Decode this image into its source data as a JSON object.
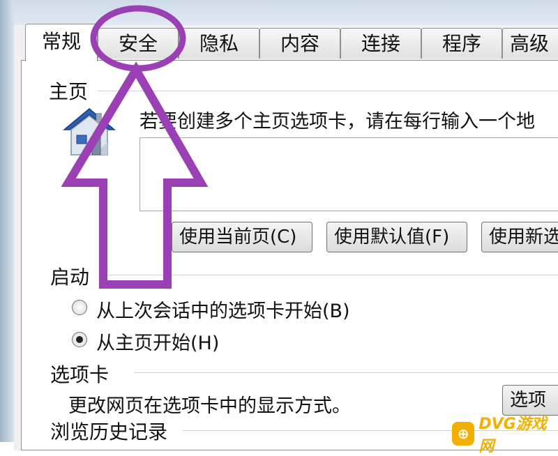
{
  "tabs": [
    "常规",
    "安全",
    "隐私",
    "内容",
    "连接",
    "程序",
    "高级"
  ],
  "home": {
    "group_title": "主页",
    "instruction": "若要创建多个主页选项卡，请在每行输入一个地",
    "address_value": "",
    "btn_current": "使用当前页(C)",
    "btn_default": "使用默认值(F)",
    "btn_new": "使用新选"
  },
  "startup": {
    "group_title": "启动",
    "option_last": "从上次会话中的选项卡开始(B)",
    "option_home": "从主页开始(H)",
    "selected": "option_home"
  },
  "tabs_section": {
    "group_title": "选项卡",
    "description": "更改网页在选项卡中的显示方式。",
    "btn_tabs": "选项"
  },
  "history": {
    "group_title": "浏览历史记录"
  },
  "annotation": {
    "color": "#9b3fb5",
    "shapes": [
      "circle-highlight",
      "up-arrow"
    ]
  },
  "watermark": {
    "text": "DVG游戏网"
  }
}
